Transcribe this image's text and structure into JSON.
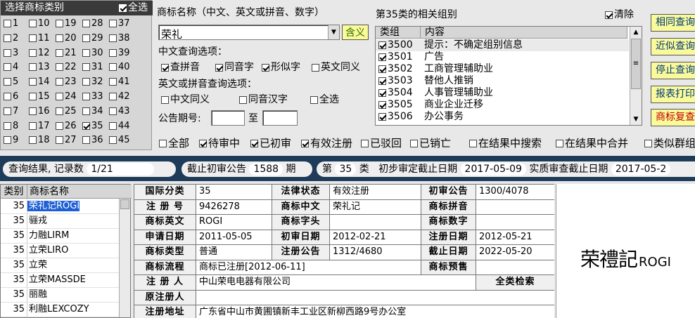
{
  "category_panel": {
    "title": "选择商标类别",
    "all_label": "全选",
    "all_checked": true,
    "categories": [
      "1",
      "10",
      "19",
      "28",
      "37",
      "2",
      "11",
      "20",
      "29",
      "38",
      "3",
      "12",
      "21",
      "30",
      "39",
      "4",
      "13",
      "22",
      "31",
      "40",
      "5",
      "14",
      "23",
      "32",
      "41",
      "6",
      "15",
      "24",
      "33",
      "42",
      "7",
      "16",
      "25",
      "34",
      "43",
      "8",
      "17",
      "26",
      "35",
      "44",
      "9",
      "18",
      "27",
      "36",
      "45"
    ],
    "checked": [
      "35"
    ]
  },
  "search": {
    "name_label": "商标名称（中文、英文或拼音、数字）",
    "name_value": "荣礼",
    "meaning_button": "含义",
    "cn_options_label": "中文查询选项：",
    "cn_options": [
      {
        "label": "查拼音",
        "checked": true
      },
      {
        "label": "同音字",
        "checked": true
      },
      {
        "label": "形似字",
        "checked": true
      },
      {
        "label": "英文同义",
        "checked": false
      }
    ],
    "en_options_label": "英文或拼音查询选项：",
    "en_options": [
      {
        "label": "中文同义",
        "checked": false
      },
      {
        "label": "同音汉字",
        "checked": false
      },
      {
        "label": "全选",
        "checked": false
      }
    ],
    "announce_label": "公告期号:",
    "to_label": "至"
  },
  "groups": {
    "title": "第35类的相关组别",
    "clear_label": "清除",
    "col_group": "类组",
    "col_content": "内容",
    "rows": [
      {
        "code": "3500",
        "text": "提示：不确定组别信息"
      },
      {
        "code": "3501",
        "text": "广告"
      },
      {
        "code": "3502",
        "text": "工商管理辅助业"
      },
      {
        "code": "3503",
        "text": "替他人推销"
      },
      {
        "code": "3504",
        "text": "人事管理辅助业"
      },
      {
        "code": "3505",
        "text": "商业企业迁移"
      },
      {
        "code": "3506",
        "text": "办公事务"
      }
    ]
  },
  "buttons": {
    "similar": "相同查询",
    "near": "近似查询",
    "stop": "停止查询",
    "report": "报表打印",
    "review": "商标复查"
  },
  "filters": [
    {
      "label": "全部",
      "checked": false
    },
    {
      "label": "待审中",
      "checked": true
    },
    {
      "label": "已初审",
      "checked": true
    },
    {
      "label": "有效注册",
      "checked": true
    },
    {
      "label": "已驳回",
      "checked": false
    },
    {
      "label": "已销亡",
      "checked": false
    },
    {
      "label": "在结果中搜索",
      "checked": false
    },
    {
      "label": "在结果中合并",
      "checked": false
    },
    {
      "label": "类似群组",
      "checked": false
    }
  ],
  "result_bar": {
    "result_label": "查询结果, 记录数",
    "result_count": "1/21",
    "prelim_label": "截止初审公告",
    "prelim_value": "1588",
    "period_label": "期",
    "class_prefix": "第",
    "class_value": "35",
    "class_suffix": "类",
    "prelim_deadline_label": "初步审定截止日期",
    "prelim_deadline": "2017-05-09",
    "exam_deadline_label": "实质审查截止日期",
    "exam_deadline": "2017-05-2"
  },
  "results": {
    "col_class": "类别",
    "col_name": "商标名称",
    "rows": [
      {
        "cls": "35",
        "name": "荣礼记ROGI"
      },
      {
        "cls": "35",
        "name": "骊戎"
      },
      {
        "cls": "35",
        "name": "力融LIRM"
      },
      {
        "cls": "35",
        "name": "立荣LIRO"
      },
      {
        "cls": "35",
        "name": "立荣"
      },
      {
        "cls": "35",
        "name": "立荣MASSDE"
      },
      {
        "cls": "35",
        "name": "丽融"
      },
      {
        "cls": "35",
        "name": "利融LEXCOZY"
      }
    ]
  },
  "detail": {
    "intl_class_k": "国际分类",
    "intl_class": "35",
    "legal_status_k": "法律状态",
    "legal_status": "有效注册",
    "prelim_pub_k": "初审公告",
    "prelim_pub": "1300/4078",
    "reg_no_k": "注 册 号",
    "reg_no": "9426278",
    "cn_name_k": "商标中文",
    "cn_name": "荣礼记",
    "pinyin_k": "商标拼音",
    "pinyin": "",
    "en_name_k": "商标英文",
    "en_name": "ROGI",
    "head_k": "商标字头",
    "head": "",
    "number_k": "商标数字",
    "number": "",
    "app_date_k": "申请日期",
    "app_date": "2011-05-05",
    "prelim_date_k": "初审日期",
    "prelim_date": "2012-02-21",
    "reg_date_k": "注册日期",
    "reg_date": "2012-05-21",
    "type_k": "商标类型",
    "type": "普通",
    "reg_pub_k": "注册公告",
    "reg_pub": "1312/4680",
    "expiry_k": "截止日期",
    "expiry": "2022-05-20",
    "flow_k": "商标流程",
    "flow": "商标已注册[2012-06-11]",
    "warn_k": "商标预售",
    "warn": "",
    "registrant_k": "注 册 人",
    "registrant": "中山荣电电器有限公司",
    "all_class_search": "全类检索",
    "orig_k": "原注册人",
    "orig": "",
    "addr_k": "注册地址",
    "addr": "广东省中山市黄圃镇新丰工业区新柳西路9号办公室"
  },
  "logo": {
    "cjk": "荣禮記",
    "latin": "ROGI"
  }
}
